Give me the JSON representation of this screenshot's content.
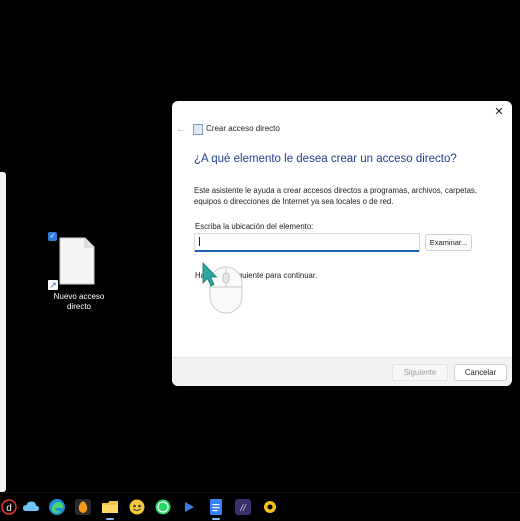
{
  "desktop": {
    "shortcut_label_line1": "Nuevo acceso",
    "shortcut_label_line2": "directo"
  },
  "dialog": {
    "window_title": "Crear acceso directo",
    "heading": "¿A qué elemento le desea crear un acceso directo?",
    "description": "Este asistente le ayuda a crear accesos directos a programas, archivos, carpetas, equipos o direcciones de Internet ya sea locales o de red.",
    "location_label": "Escriba la ubicación del elemento:",
    "location_value": "",
    "browse_label": "Examinar...",
    "hint_prefix": "Ha",
    "hint_suffix": "Siguiente para continuar.",
    "next_label": "Siguiente",
    "cancel_label": "Cancelar",
    "close_glyph": "✕",
    "back_glyph": "←"
  },
  "taskbar": {
    "icons": [
      "d-app-icon",
      "cloud-icon",
      "edge-icon",
      "fruity-icon",
      "file-explorer-icon",
      "emoji-icon",
      "whatsapp-icon",
      "play-icon",
      "docs-icon",
      "app-icon",
      "settings-icon"
    ]
  },
  "colors": {
    "heading": "#1f3f8f",
    "accent": "#1f5fb0",
    "cursor": "#2aa8a0"
  }
}
